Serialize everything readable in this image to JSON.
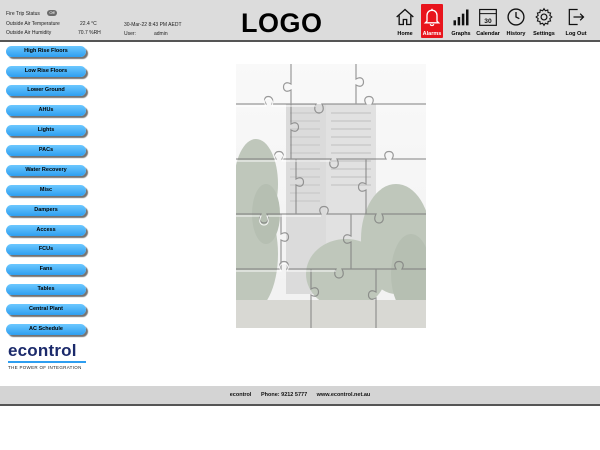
{
  "status": {
    "fire_trip_label": "Fire Trip Status",
    "fire_trip_value": "Off",
    "outside_temp_label": "Outside Air Temperature",
    "outside_temp_value": "22.4 °C",
    "outside_humidity_label": "Outside Air Humidity",
    "outside_humidity_value": "70.7 %RH",
    "datetime": "30-Mar-22 8:43 PM AEDT",
    "user_label": "User:",
    "user_value": "admin"
  },
  "logo": "LOGO",
  "nav": [
    {
      "label": "Home",
      "icon": "home-icon",
      "active": false
    },
    {
      "label": "Alarms",
      "icon": "bell-icon",
      "active": true
    },
    {
      "label": "Graphs",
      "icon": "bar-chart-icon",
      "active": false
    },
    {
      "label": "Calendar",
      "icon": "calendar-icon",
      "active": false,
      "day": "30"
    },
    {
      "label": "History",
      "icon": "clock-icon",
      "active": false
    },
    {
      "label": "Settings",
      "icon": "gear-icon",
      "active": false
    },
    {
      "label": "Log Out",
      "icon": "logout-icon",
      "active": false
    }
  ],
  "sidebar": [
    "High Rise Floors",
    "Low Rise Floors",
    "Lower Ground",
    "AHUs",
    "Lights",
    "PACs",
    "Water Recovery",
    "Misc",
    "Dampers",
    "Access",
    "FCUs",
    "Fans",
    "Tables",
    "Central Plant",
    "AC Schedule"
  ],
  "brand": {
    "name": "econtrol",
    "tagline": "THE POWER OF INTEGRATION"
  },
  "footer": {
    "company": "econtrol",
    "phone": "Phone: 9212 5777",
    "website": "www.econtrol.net.au"
  },
  "colors": {
    "accent": "#2e9ef0",
    "alarm": "#e8141c",
    "header_bg": "#dcdcdc"
  }
}
